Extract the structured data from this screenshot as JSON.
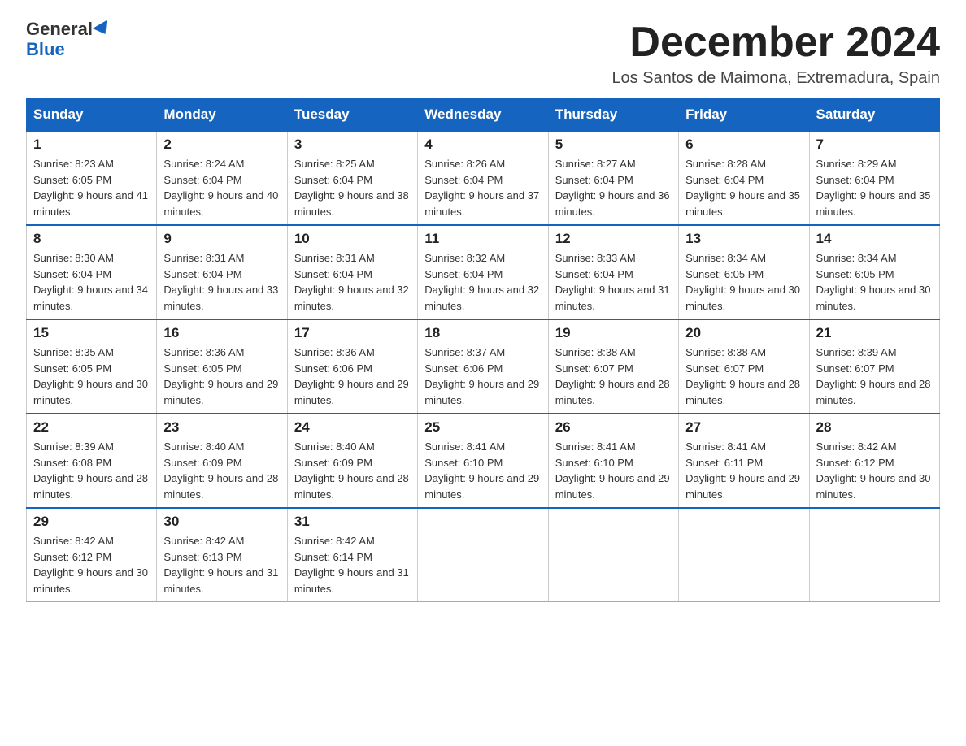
{
  "header": {
    "logo_line1": "General",
    "logo_line2": "Blue",
    "main_title": "December 2024",
    "subtitle": "Los Santos de Maimona, Extremadura, Spain"
  },
  "days_of_week": [
    "Sunday",
    "Monday",
    "Tuesday",
    "Wednesday",
    "Thursday",
    "Friday",
    "Saturday"
  ],
  "weeks": [
    [
      {
        "day": "1",
        "sunrise": "8:23 AM",
        "sunset": "6:05 PM",
        "daylight": "9 hours and 41 minutes."
      },
      {
        "day": "2",
        "sunrise": "8:24 AM",
        "sunset": "6:04 PM",
        "daylight": "9 hours and 40 minutes."
      },
      {
        "day": "3",
        "sunrise": "8:25 AM",
        "sunset": "6:04 PM",
        "daylight": "9 hours and 38 minutes."
      },
      {
        "day": "4",
        "sunrise": "8:26 AM",
        "sunset": "6:04 PM",
        "daylight": "9 hours and 37 minutes."
      },
      {
        "day": "5",
        "sunrise": "8:27 AM",
        "sunset": "6:04 PM",
        "daylight": "9 hours and 36 minutes."
      },
      {
        "day": "6",
        "sunrise": "8:28 AM",
        "sunset": "6:04 PM",
        "daylight": "9 hours and 35 minutes."
      },
      {
        "day": "7",
        "sunrise": "8:29 AM",
        "sunset": "6:04 PM",
        "daylight": "9 hours and 35 minutes."
      }
    ],
    [
      {
        "day": "8",
        "sunrise": "8:30 AM",
        "sunset": "6:04 PM",
        "daylight": "9 hours and 34 minutes."
      },
      {
        "day": "9",
        "sunrise": "8:31 AM",
        "sunset": "6:04 PM",
        "daylight": "9 hours and 33 minutes."
      },
      {
        "day": "10",
        "sunrise": "8:31 AM",
        "sunset": "6:04 PM",
        "daylight": "9 hours and 32 minutes."
      },
      {
        "day": "11",
        "sunrise": "8:32 AM",
        "sunset": "6:04 PM",
        "daylight": "9 hours and 32 minutes."
      },
      {
        "day": "12",
        "sunrise": "8:33 AM",
        "sunset": "6:04 PM",
        "daylight": "9 hours and 31 minutes."
      },
      {
        "day": "13",
        "sunrise": "8:34 AM",
        "sunset": "6:05 PM",
        "daylight": "9 hours and 30 minutes."
      },
      {
        "day": "14",
        "sunrise": "8:34 AM",
        "sunset": "6:05 PM",
        "daylight": "9 hours and 30 minutes."
      }
    ],
    [
      {
        "day": "15",
        "sunrise": "8:35 AM",
        "sunset": "6:05 PM",
        "daylight": "9 hours and 30 minutes."
      },
      {
        "day": "16",
        "sunrise": "8:36 AM",
        "sunset": "6:05 PM",
        "daylight": "9 hours and 29 minutes."
      },
      {
        "day": "17",
        "sunrise": "8:36 AM",
        "sunset": "6:06 PM",
        "daylight": "9 hours and 29 minutes."
      },
      {
        "day": "18",
        "sunrise": "8:37 AM",
        "sunset": "6:06 PM",
        "daylight": "9 hours and 29 minutes."
      },
      {
        "day": "19",
        "sunrise": "8:38 AM",
        "sunset": "6:07 PM",
        "daylight": "9 hours and 28 minutes."
      },
      {
        "day": "20",
        "sunrise": "8:38 AM",
        "sunset": "6:07 PM",
        "daylight": "9 hours and 28 minutes."
      },
      {
        "day": "21",
        "sunrise": "8:39 AM",
        "sunset": "6:07 PM",
        "daylight": "9 hours and 28 minutes."
      }
    ],
    [
      {
        "day": "22",
        "sunrise": "8:39 AM",
        "sunset": "6:08 PM",
        "daylight": "9 hours and 28 minutes."
      },
      {
        "day": "23",
        "sunrise": "8:40 AM",
        "sunset": "6:09 PM",
        "daylight": "9 hours and 28 minutes."
      },
      {
        "day": "24",
        "sunrise": "8:40 AM",
        "sunset": "6:09 PM",
        "daylight": "9 hours and 28 minutes."
      },
      {
        "day": "25",
        "sunrise": "8:41 AM",
        "sunset": "6:10 PM",
        "daylight": "9 hours and 29 minutes."
      },
      {
        "day": "26",
        "sunrise": "8:41 AM",
        "sunset": "6:10 PM",
        "daylight": "9 hours and 29 minutes."
      },
      {
        "day": "27",
        "sunrise": "8:41 AM",
        "sunset": "6:11 PM",
        "daylight": "9 hours and 29 minutes."
      },
      {
        "day": "28",
        "sunrise": "8:42 AM",
        "sunset": "6:12 PM",
        "daylight": "9 hours and 30 minutes."
      }
    ],
    [
      {
        "day": "29",
        "sunrise": "8:42 AM",
        "sunset": "6:12 PM",
        "daylight": "9 hours and 30 minutes."
      },
      {
        "day": "30",
        "sunrise": "8:42 AM",
        "sunset": "6:13 PM",
        "daylight": "9 hours and 31 minutes."
      },
      {
        "day": "31",
        "sunrise": "8:42 AM",
        "sunset": "6:14 PM",
        "daylight": "9 hours and 31 minutes."
      },
      null,
      null,
      null,
      null
    ]
  ]
}
